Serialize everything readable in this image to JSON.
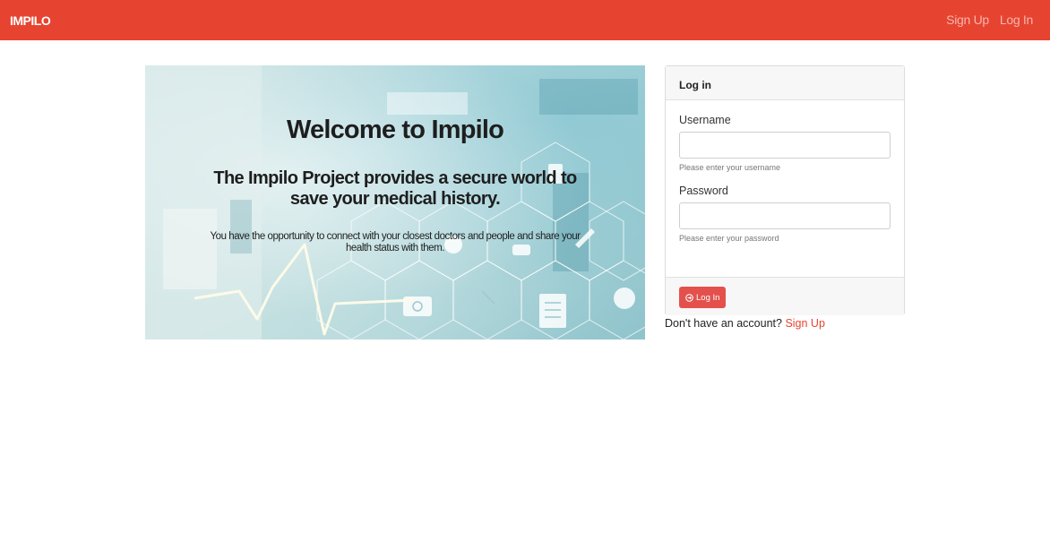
{
  "app": {
    "brand": "IMPILO"
  },
  "navbar": {
    "links": [
      {
        "label": "Sign Up"
      },
      {
        "label": "Log In"
      }
    ]
  },
  "hero": {
    "title": "Welcome to Impilo",
    "subtitle": "The Impilo Project provides a secure world to save your medical history.",
    "text": "You have the opportunity to connect with your closest doctors and people and share your health status with them."
  },
  "login": {
    "header": "Log in",
    "username_label": "Username",
    "username_value": "",
    "username_help": "Please enter your username",
    "password_label": "Password",
    "password_value": "",
    "password_help": "Please enter your password",
    "submit_label": "Log In",
    "submit_icon": "sign-in-icon"
  },
  "footer_prompt": {
    "text": "Don't have an account?",
    "link": "Sign Up"
  },
  "colors": {
    "navbar": "#e64431",
    "button": "#e4514d",
    "link": "#e64431"
  }
}
